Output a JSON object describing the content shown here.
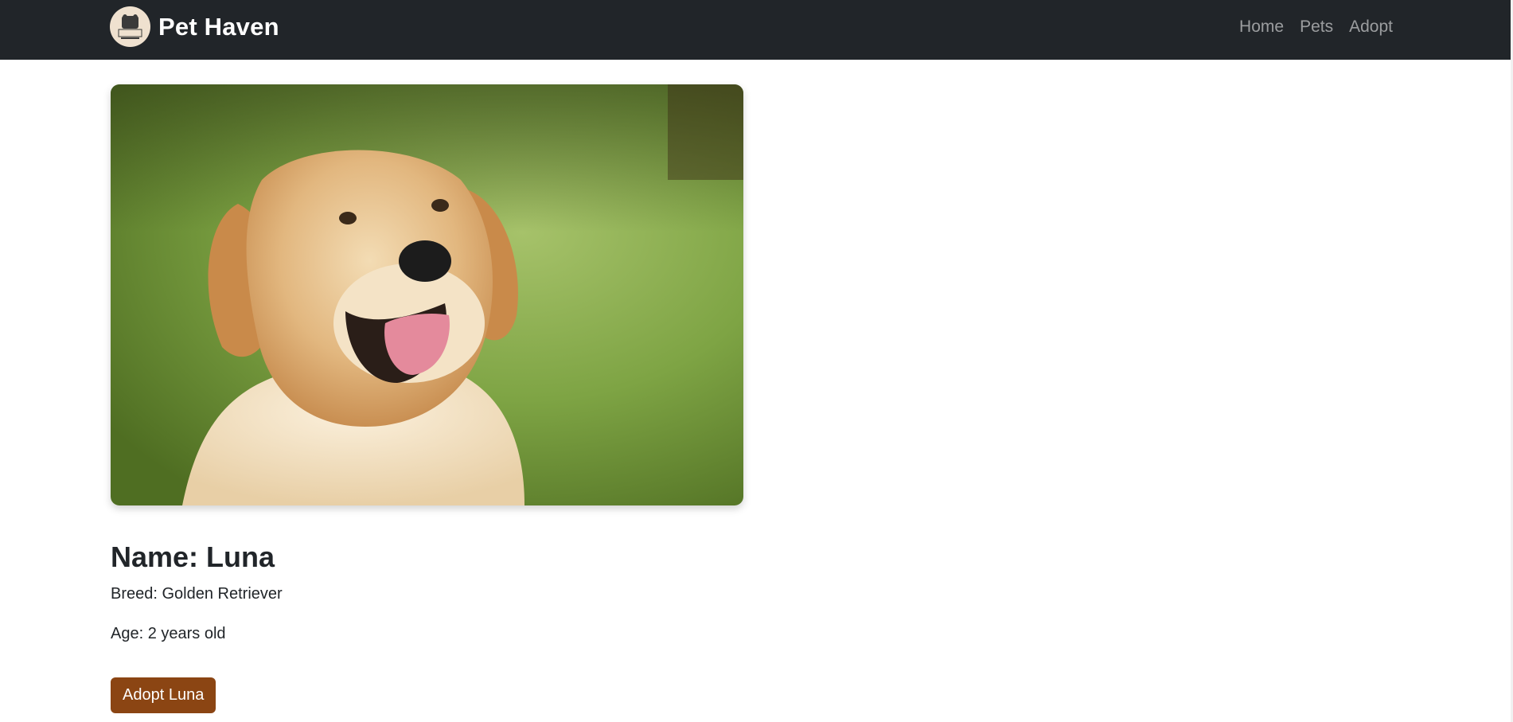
{
  "navbar": {
    "brand_name": "Pet Haven",
    "logo_icon": "pet-haven-logo-icon",
    "links": [
      {
        "label": "Home"
      },
      {
        "label": "Pets"
      },
      {
        "label": "Adopt"
      }
    ]
  },
  "pet": {
    "photo_subject": "golden-retriever-photo",
    "name_line": "Name: Luna",
    "breed_line": "Breed: Golden Retriever",
    "age_line": "Age: 2 years old",
    "adopt_button_label": "Adopt Luna"
  },
  "colors": {
    "navbar_bg": "#212529",
    "accent_button": "#8b4513",
    "nav_link": "rgba(255,255,255,0.55)"
  }
}
